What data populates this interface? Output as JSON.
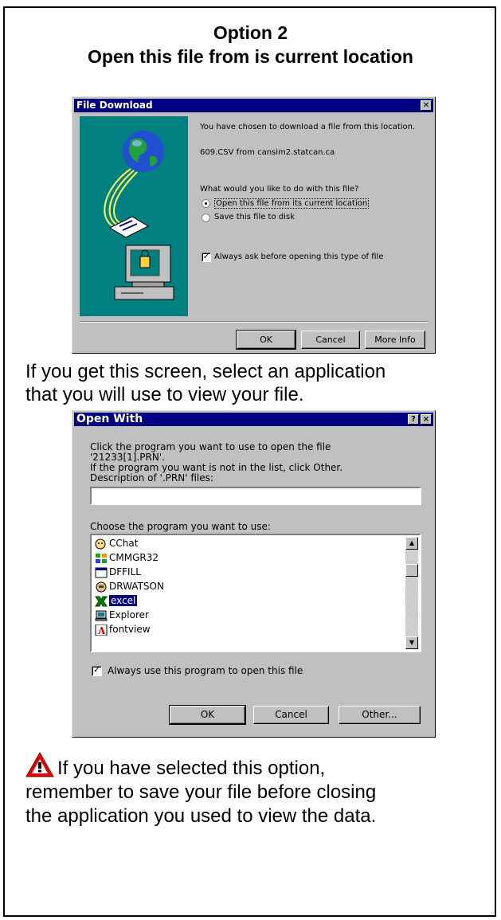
{
  "heading": {
    "line1": "Option 2",
    "line2": "Open this file from is current location"
  },
  "file_download": {
    "title": "File Download",
    "message": "You have chosen to download a file from this location.",
    "source": "609.CSV from cansim2.statcan.ca",
    "question": "What would you like to do with this file?",
    "option_open": "Open this file from its current location",
    "option_save": "Save this file to disk",
    "always_ask": "Always ask before opening this type of file",
    "ok": "OK",
    "cancel": "Cancel",
    "more_info": "More Info",
    "selected_option": "open",
    "always_ask_checked": true
  },
  "instruction": {
    "line1": "If you get this screen, select an application",
    "line2": "that you will use to view your file."
  },
  "open_with": {
    "title": "Open With",
    "help_btn": "?",
    "close_btn": "×",
    "line1": "Click the program you want to use to open the file",
    "line2": "'21233[1].PRN'.",
    "line3": "If the program you want is not in the list, click Other.",
    "desc_label": "Description of '.PRN' files:",
    "desc_value": "",
    "choose_label": "Choose the program you want to use:",
    "programs": [
      "CChat",
      "CMMGR32",
      "DFFILL",
      "DRWATSON",
      "excel",
      "Explorer",
      "fontview"
    ],
    "selected_program": "excel",
    "always_use": "Always use this program to open this file",
    "always_use_checked": true,
    "ok": "OK",
    "cancel": "Cancel",
    "other": "Other..."
  },
  "warning": {
    "line1": "If you have selected this option,",
    "line2": "remember to save your file before closing",
    "line3": "the application you used to view the data."
  },
  "colors": {
    "titlebar": "#000080",
    "dialog_bg": "#c0c0c0",
    "teal_panel": "#008080",
    "warning_red": "#e00000"
  },
  "icons": {
    "download_illustration": "globe-computer-illustration",
    "warning": "warning-triangle-icon"
  }
}
